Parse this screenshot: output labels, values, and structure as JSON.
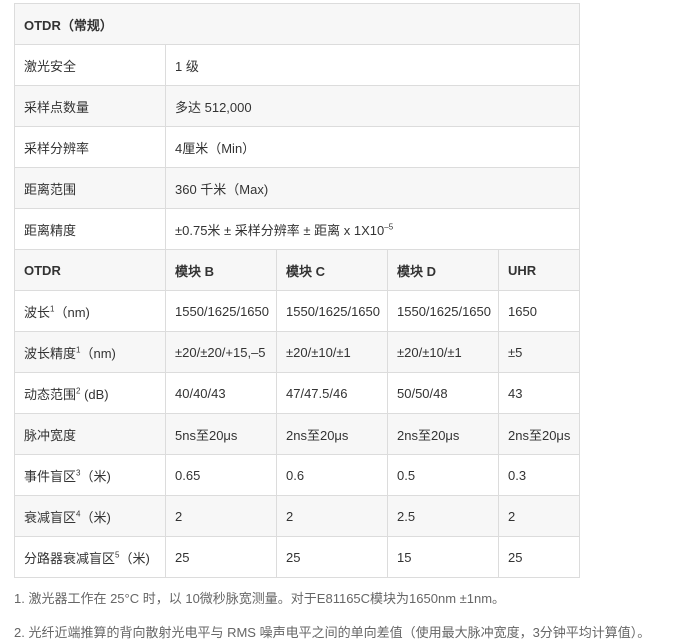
{
  "top_table": {
    "title": "OTDR（常规）",
    "rows": [
      {
        "label": "激光安全",
        "value": "1 级"
      },
      {
        "label": "采样点数量",
        "value": "多达 512,000"
      },
      {
        "label": "采样分辨率",
        "value": "4厘米（Min）"
      },
      {
        "label": "距离范围",
        "value": "360 千米（Max)"
      },
      {
        "label": "距离精度",
        "value": "±0.75米 ± 采样分辨率 ± 距离 x 1X10",
        "value_sup": "–5"
      }
    ]
  },
  "module_table": {
    "header": {
      "label": "OTDR",
      "columns": [
        "模块 B",
        "模块 C",
        "模块 D",
        "UHR"
      ]
    },
    "rows": [
      {
        "label": "波长",
        "sup": "1",
        "suffix": "（nm)",
        "values": [
          "1550/1625/1650",
          "1550/1625/1650",
          "1550/1625/1650",
          "1650"
        ]
      },
      {
        "label": "波长精度",
        "sup": "1",
        "suffix": "（nm)",
        "values": [
          "±20/±20/+15,–5",
          "±20/±10/±1",
          "±20/±10/±1",
          "±5"
        ]
      },
      {
        "label": "动态范围",
        "sup": "2",
        "suffix": " (dB)",
        "values": [
          "40/40/43",
          "47/47.5/46",
          "50/50/48",
          "43"
        ]
      },
      {
        "label": "脉冲宽度",
        "sup": "",
        "suffix": "",
        "values": [
          "5ns至20μs",
          "2ns至20μs",
          "2ns至20μs",
          "2ns至20μs"
        ]
      },
      {
        "label": "事件盲区",
        "sup": "3",
        "suffix": "（米)",
        "values": [
          "0.65",
          "0.6",
          "0.5",
          "0.3"
        ]
      },
      {
        "label": "衰减盲区",
        "sup": "4",
        "suffix": "（米)",
        "values": [
          "2",
          "2",
          "2.5",
          "2"
        ]
      },
      {
        "label": "分路器衰减盲区",
        "sup": "5",
        "suffix": "（米)",
        "values": [
          "25",
          "25",
          "15",
          "25"
        ]
      }
    ]
  },
  "footnotes": [
    "1. 激光器工作在 25°C 时，以 10微秒脉宽测量。对于E81165C模块为1650nm ±1nm。",
    "2. 光纤近端推算的背向散射光电平与 RMS 噪声电平之间的单向差值（使用最大脉冲宽度，3分钟平均计算值）。"
  ]
}
